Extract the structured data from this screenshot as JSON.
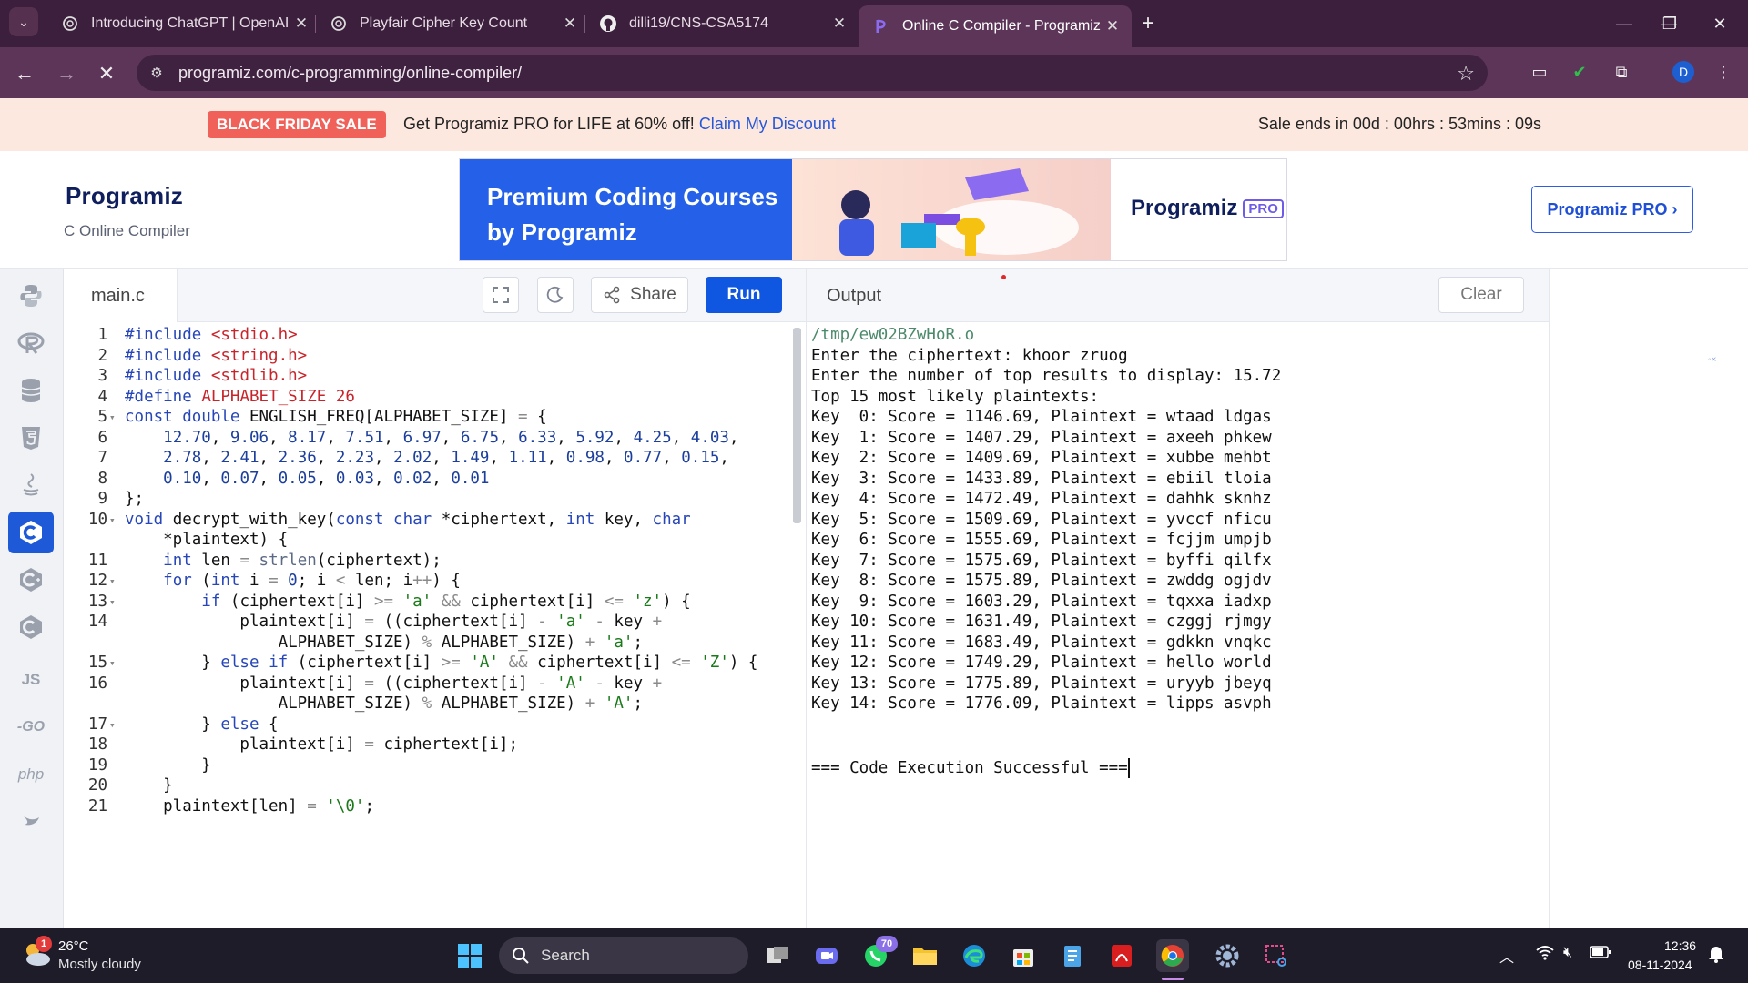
{
  "browser": {
    "tabs": [
      {
        "title": "Introducing ChatGPT | OpenAI",
        "icon": "openai-icon"
      },
      {
        "title": "Playfair Cipher Key Count",
        "icon": "openai-icon"
      },
      {
        "title": "dilli19/CNS-CSA5174",
        "icon": "github-icon"
      },
      {
        "title": "Online C Compiler - Programiz",
        "icon": "programiz-icon",
        "active": true
      }
    ],
    "url": "programiz.com/c-programming/online-compiler/",
    "profile_initial": "D"
  },
  "sale": {
    "badge": "BLACK FRIDAY SALE",
    "text": "Get Programiz PRO for LIFE at 60% off!",
    "link": "Claim My Discount",
    "ends": "Sale ends in 00d : 00hrs : 53mins : 09s"
  },
  "header": {
    "logo": "Programiz",
    "subtitle": "C Online Compiler",
    "ad_title": "Premium Coding Courses by Programiz",
    "ad_logo": "Programiz",
    "ad_pro": "PRO",
    "pro_button": "Programiz PRO ›"
  },
  "rail": {
    "languages": [
      "python-icon",
      "r-icon",
      "sql-icon",
      "html5-icon",
      "java-icon",
      "c-icon",
      "cpp-icon",
      "csharp-icon",
      "js-icon",
      "go-icon",
      "php-icon",
      "swift-icon"
    ],
    "labels": {
      "js": "JS",
      "go": "-GO",
      "php": "php"
    }
  },
  "editor": {
    "filename": "main.c",
    "share_label": "Share",
    "run_label": "Run",
    "lines": [
      {
        "n": "1",
        "fold": false
      },
      {
        "n": "2",
        "fold": false
      },
      {
        "n": "3",
        "fold": false
      },
      {
        "n": "4",
        "fold": false
      },
      {
        "n": "5",
        "fold": true
      },
      {
        "n": "6",
        "fold": false
      },
      {
        "n": "7",
        "fold": false
      },
      {
        "n": "8",
        "fold": false
      },
      {
        "n": "9",
        "fold": false
      },
      {
        "n": "10",
        "fold": true
      },
      {
        "n": "",
        "fold": false
      },
      {
        "n": "11",
        "fold": false
      },
      {
        "n": "12",
        "fold": true
      },
      {
        "n": "13",
        "fold": true
      },
      {
        "n": "14",
        "fold": false
      },
      {
        "n": "",
        "fold": false
      },
      {
        "n": "15",
        "fold": true
      },
      {
        "n": "16",
        "fold": false
      },
      {
        "n": "",
        "fold": false
      },
      {
        "n": "17",
        "fold": true
      },
      {
        "n": "18",
        "fold": false
      },
      {
        "n": "19",
        "fold": false
      },
      {
        "n": "20",
        "fold": false
      },
      {
        "n": "21",
        "fold": false
      }
    ],
    "code": [
      "#include <stdio.h>",
      "#include <string.h>",
      "#include <stdlib.h>",
      "#define ALPHABET_SIZE 26",
      "const double ENGLISH_FREQ[ALPHABET_SIZE] = {",
      "    12.70, 9.06, 8.17, 7.51, 6.97, 6.75, 6.33, 5.92, 4.25, 4.03,",
      "    2.78, 2.41, 2.36, 2.23, 2.02, 1.49, 1.11, 0.98, 0.77, 0.15,",
      "    0.10, 0.07, 0.05, 0.03, 0.02, 0.01",
      "};",
      "void decrypt_with_key(const char *ciphertext, int key, char",
      "    *plaintext) {",
      "    int len = strlen(ciphertext);",
      "    for (int i = 0; i < len; i++) {",
      "        if (ciphertext[i] >= 'a' && ciphertext[i] <= 'z') {",
      "            plaintext[i] = ((ciphertext[i] - 'a' - key +",
      "                ALPHABET_SIZE) % ALPHABET_SIZE) + 'a';",
      "        } else if (ciphertext[i] >= 'A' && ciphertext[i] <= 'Z') {",
      "            plaintext[i] = ((ciphertext[i] - 'A' - key +",
      "                ALPHABET_SIZE) % ALPHABET_SIZE) + 'A';",
      "        } else {",
      "            plaintext[i] = ciphertext[i];",
      "        }",
      "    }",
      "    plaintext[len] = '\\0';"
    ]
  },
  "output": {
    "title": "Output",
    "clear_label": "Clear",
    "lines": [
      "/tmp/ew02BZwHoR.o",
      "Enter the ciphertext: khoor zruog",
      "Enter the number of top results to display: 15.72",
      "Top 15 most likely plaintexts:",
      "Key  0: Score = 1146.69, Plaintext = wtaad ldgas",
      "Key  1: Score = 1407.29, Plaintext = axeeh phkew",
      "Key  2: Score = 1409.69, Plaintext = xubbe mehbt",
      "Key  3: Score = 1433.89, Plaintext = ebiil tloia",
      "Key  4: Score = 1472.49, Plaintext = dahhk sknhz",
      "Key  5: Score = 1509.69, Plaintext = yvccf nficu",
      "Key  6: Score = 1555.69, Plaintext = fcjjm umpjb",
      "Key  7: Score = 1575.69, Plaintext = byffi qilfx",
      "Key  8: Score = 1575.89, Plaintext = zwddg ogjdv",
      "Key  9: Score = 1603.29, Plaintext = tqxxa iadxp",
      "Key 10: Score = 1631.49, Plaintext = czggj rjmgy",
      "Key 11: Score = 1683.49, Plaintext = gdkkn vnqkc",
      "Key 12: Score = 1749.29, Plaintext = hello world",
      "Key 13: Score = 1775.89, Plaintext = uryyb jbeyq",
      "Key 14: Score = 1776.09, Plaintext = lipps asvph"
    ],
    "footer": "=== Code Execution Successful ==="
  },
  "taskbar": {
    "temperature": "26°C",
    "weather": "Mostly cloudy",
    "weather_badge": "1",
    "search_label": "Search",
    "whatsapp_badge": "70",
    "time": "12:36",
    "date": "08-11-2024"
  }
}
